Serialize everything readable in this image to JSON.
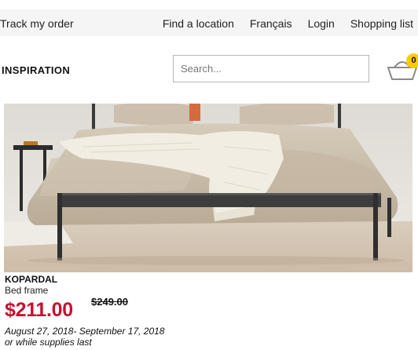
{
  "top_bar": {
    "track_order": "Track my order",
    "links": [
      "Find a location",
      "Français",
      "Login",
      "Shopping list"
    ]
  },
  "header": {
    "nav_item": "INSPIRATION",
    "search_placeholder": "Search...",
    "cart_count": "0"
  },
  "product": {
    "name": "KOPARDAL",
    "type": "Bed frame",
    "price_now": "$211.00",
    "price_was": "$249.00",
    "date_range": "August 27, 2018- September 17, 2018",
    "availability": "or while supplies last"
  },
  "colors": {
    "price_red": "#c8102e",
    "badge_yellow": "#ffcc00",
    "top_bar_bg": "#f5f5f5"
  }
}
